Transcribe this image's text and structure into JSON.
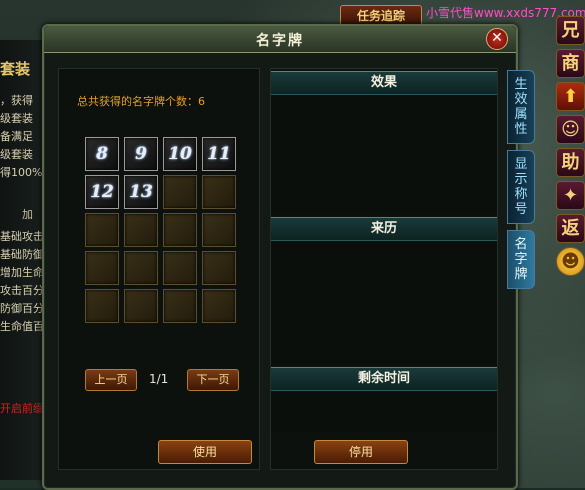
{
  "background": {
    "left_panel_title": "套装",
    "left_panel_lines": [
      "，获得",
      "级套装",
      "备满足",
      "级套装",
      "得100%"
    ],
    "left_panel_subtitle": "加",
    "left_panel_stats": [
      "基础攻击",
      "基础防御",
      "增加生命",
      "攻击百分",
      "防御百分",
      "生命值百"
    ],
    "left_panel_red_line": "开启前缀",
    "quest_tab_label": "任务追踪",
    "watermark": "小雪代售www.xxds777.com"
  },
  "right_icons": [
    {
      "glyph": "兄",
      "name": "brother-icon"
    },
    {
      "glyph": "商",
      "name": "shop-icon"
    },
    {
      "glyph": "⬆",
      "name": "upgrade-arrow-icon"
    },
    {
      "glyph": "☺",
      "name": "character-icon"
    },
    {
      "glyph": "助",
      "name": "help-icon"
    },
    {
      "glyph": "✦",
      "name": "skill-icon"
    },
    {
      "glyph": "返",
      "name": "return-icon"
    },
    {
      "glyph": "☻",
      "name": "smile-icon"
    }
  ],
  "side_tabs": [
    {
      "label": "生效属性",
      "active": false
    },
    {
      "label": "显示称号",
      "active": false
    },
    {
      "label": "名字牌",
      "active": true
    }
  ],
  "dialog": {
    "title": "名字牌",
    "close_label": "✕",
    "count_label": "总共获得的名字牌个数：",
    "count_value": "6",
    "slots": [
      {
        "glyph": "8",
        "filled": true
      },
      {
        "glyph": "9",
        "filled": true
      },
      {
        "glyph": "10",
        "filled": true
      },
      {
        "glyph": "11",
        "filled": true
      },
      {
        "glyph": "12",
        "filled": true
      },
      {
        "glyph": "13",
        "filled": true
      },
      {
        "glyph": "",
        "filled": false
      },
      {
        "glyph": "",
        "filled": false
      },
      {
        "glyph": "",
        "filled": false
      },
      {
        "glyph": "",
        "filled": false
      },
      {
        "glyph": "",
        "filled": false
      },
      {
        "glyph": "",
        "filled": false
      },
      {
        "glyph": "",
        "filled": false
      },
      {
        "glyph": "",
        "filled": false
      },
      {
        "glyph": "",
        "filled": false
      },
      {
        "glyph": "",
        "filled": false
      },
      {
        "glyph": "",
        "filled": false
      },
      {
        "glyph": "",
        "filled": false
      },
      {
        "glyph": "",
        "filled": false
      },
      {
        "glyph": "",
        "filled": false
      }
    ],
    "prev_label": "上一页",
    "next_label": "下一页",
    "page_indicator": "1/1",
    "section_effect": "效果",
    "section_source": "来历",
    "section_time": "剩余时间",
    "use_label": "使用",
    "disable_label": "停用"
  },
  "colors": {
    "accent_gold": "#e8a020",
    "title_text": "#f4f0d8",
    "button_brown": "#7a3a12",
    "tab_blue": "#9fe0ff"
  }
}
